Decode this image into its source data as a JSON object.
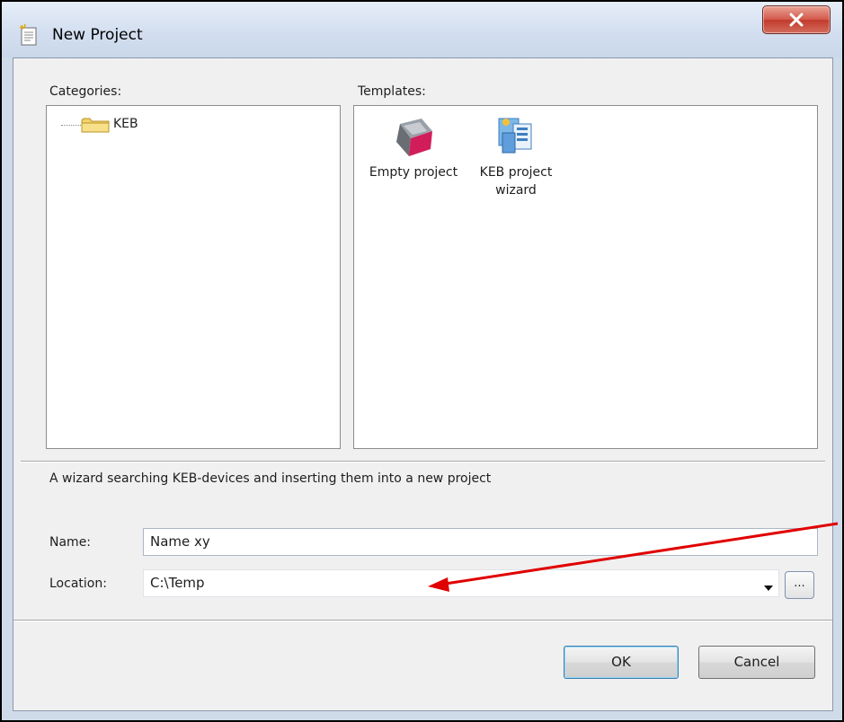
{
  "window": {
    "title": "New Project",
    "close_glyph": "x"
  },
  "categories": {
    "label": "Categories:",
    "items": [
      {
        "label": "KEB",
        "icon": "folder-icon"
      }
    ]
  },
  "templates": {
    "label": "Templates:",
    "items": [
      {
        "label": "Empty project",
        "icon": "empty-project-icon"
      },
      {
        "label": "KEB project wizard",
        "icon": "keb-wizard-icon"
      }
    ]
  },
  "description": "A wizard searching KEB-devices and inserting them into a new project",
  "form": {
    "name_label": "Name:",
    "name_value": "Name xy",
    "location_label": "Location:",
    "location_value": "C:\\Temp",
    "browse_label": "..."
  },
  "buttons": {
    "ok": "OK",
    "cancel": "Cancel"
  },
  "colors": {
    "annotation_arrow": "#e00000",
    "close_button": "#c94536"
  }
}
